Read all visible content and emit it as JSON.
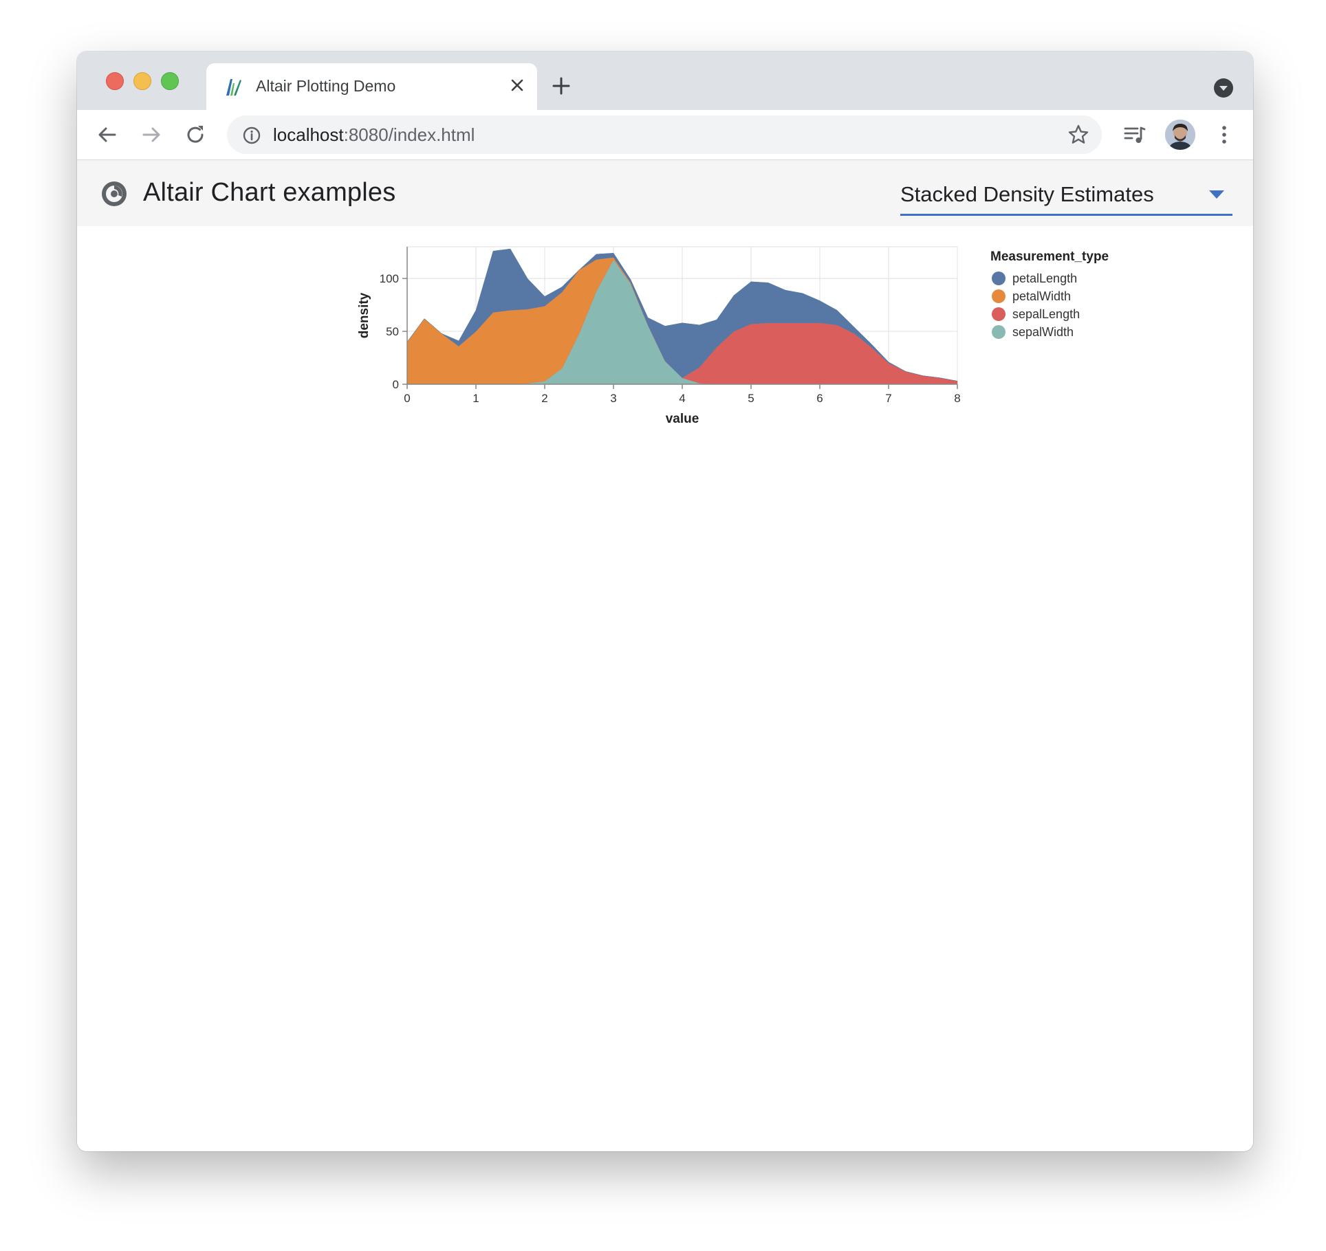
{
  "browser": {
    "tab_title": "Altair Plotting Demo",
    "url_host": "localhost",
    "url_rest": ":8080/index.html"
  },
  "app": {
    "title": "Altair Chart examples",
    "selected_example": "Stacked Density Estimates"
  },
  "icons": {
    "close_window": "close-window-icon",
    "minimize_window": "minimize-window-icon",
    "maximize_window": "maximize-window-icon",
    "tab_favicon": "altair-favicon-icon",
    "tab_close": "close-icon",
    "new_tab": "plus-icon",
    "tab_search": "chevron-down-icon",
    "back": "arrow-left-icon",
    "forward": "arrow-right-icon",
    "reload": "reload-icon",
    "site_info": "info-icon",
    "bookmark": "star-icon",
    "media": "media-queue-icon",
    "profile": "avatar",
    "menu": "kebab-icon",
    "app_logo": "app-logo-icon",
    "dropdown": "caret-down-icon"
  },
  "chart_data": {
    "type": "area",
    "stacked": true,
    "xlabel": "value",
    "ylabel": "density",
    "xlim": [
      0,
      8
    ],
    "ylim": [
      0,
      130
    ],
    "x_ticks": [
      0,
      1,
      2,
      3,
      4,
      5,
      6,
      7,
      8
    ],
    "y_ticks": [
      0,
      50,
      100
    ],
    "grid": true,
    "legend_title": "Measurement_type",
    "legend_position": "right",
    "x": [
      0,
      0.25,
      0.5,
      0.75,
      1,
      1.25,
      1.5,
      1.75,
      2,
      2.25,
      2.5,
      2.75,
      3,
      3.25,
      3.5,
      3.75,
      4,
      4.25,
      4.5,
      4.75,
      5,
      5.25,
      5.5,
      5.75,
      6,
      6.25,
      6.5,
      6.75,
      7,
      7.25,
      7.5,
      7.75,
      8
    ],
    "series": [
      {
        "name": "sepalWidth",
        "color": "#88bab3",
        "values": [
          0,
          0,
          0,
          0,
          0,
          0,
          0,
          1,
          3,
          15,
          48,
          88,
          118,
          95,
          56,
          22,
          6,
          1,
          0,
          0,
          0,
          0,
          0,
          0,
          0,
          0,
          0,
          0,
          0,
          0,
          0,
          0,
          0
        ]
      },
      {
        "name": "sepalLength",
        "color": "#d95e5c",
        "values": [
          0,
          0,
          0,
          0,
          0,
          0,
          0,
          0,
          0,
          0,
          0,
          0,
          0,
          0,
          0,
          0,
          0,
          15,
          35,
          50,
          57,
          58,
          58,
          58,
          58,
          56,
          48,
          35,
          20,
          12,
          8,
          6,
          3
        ]
      },
      {
        "name": "petalWidth",
        "color": "#e58a3c",
        "values": [
          40,
          62,
          48,
          36,
          50,
          68,
          70,
          70,
          71,
          72,
          60,
          30,
          2,
          1,
          0,
          0,
          0,
          0,
          0,
          0,
          0,
          0,
          0,
          0,
          0,
          0,
          0,
          0,
          0,
          0,
          0,
          0,
          0
        ]
      },
      {
        "name": "petalLength",
        "color": "#5778a5",
        "values": [
          0,
          0,
          0,
          5,
          20,
          58,
          58,
          29,
          9,
          5,
          0,
          5,
          4,
          3,
          7,
          33,
          52,
          40,
          26,
          34,
          40,
          38,
          31,
          28,
          21,
          14,
          6,
          3,
          1,
          0,
          0,
          0,
          0
        ]
      }
    ],
    "legend_order": [
      "petalLength",
      "petalWidth",
      "sepalLength",
      "sepalWidth"
    ]
  }
}
